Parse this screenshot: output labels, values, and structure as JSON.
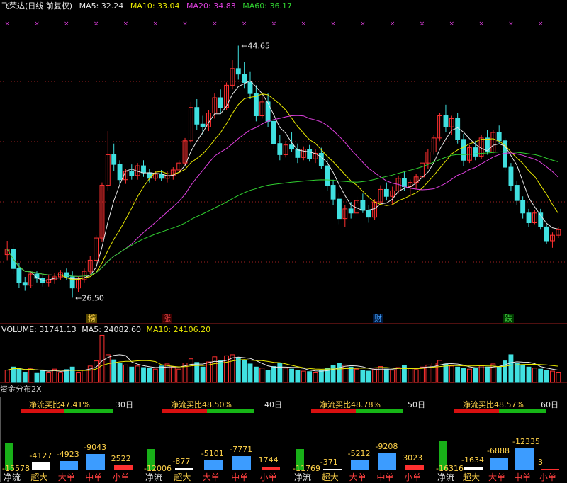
{
  "header": {
    "stock_name": "飞荣达(日线 前复权)",
    "ma_values": [
      {
        "label": "MA5: 32.24",
        "color": "#e8e8e8"
      },
      {
        "label": "MA10: 33.04",
        "color": "#e8e800"
      },
      {
        "label": "MA20: 34.83",
        "color": "#e040e0"
      },
      {
        "label": "MA60: 36.17",
        "color": "#30d030"
      }
    ]
  },
  "price_chart": {
    "high_label": "44.65",
    "low_label": "26.50",
    "markers": [
      {
        "text": "榜",
        "color": "#ffd24a"
      },
      {
        "text": "涨",
        "color": "#e04040"
      },
      {
        "text": "财",
        "color": "#40a0ff"
      },
      {
        "text": "跌",
        "color": "#40d040"
      }
    ],
    "colors": {
      "up": "#ff3030",
      "down": "#40e0e0",
      "ma5": "#e8e8e8",
      "ma10": "#e8e800",
      "ma20": "#e040e0",
      "ma60": "#30d030",
      "grid": "#a02020",
      "signal": "#e040e0"
    }
  },
  "volume_header": {
    "volume": "VOLUME: 31741.13",
    "ma5": "MA5: 24082.60",
    "ma10": "MA10: 24106.20"
  },
  "fund_flow": {
    "title": "资金分布2X",
    "categories": [
      "净流",
      "超大",
      "大单",
      "中单",
      "小单"
    ],
    "panels": [
      {
        "days": "30日",
        "ratio_label": "净流买比47.41%",
        "ratio": 47.41,
        "values": [
          -15578,
          -4127,
          -4923,
          -9043,
          2522
        ],
        "value_labels": [
          "-15578",
          "-4127",
          "-4923",
          "-9043",
          "2522"
        ]
      },
      {
        "days": "40日",
        "ratio_label": "净流买比48.50%",
        "ratio": 48.5,
        "values": [
          -12006,
          -877,
          -5101,
          -7771,
          1744
        ],
        "value_labels": [
          "-12006",
          "-877",
          "-5101",
          "-7771",
          "1744"
        ]
      },
      {
        "days": "50日",
        "ratio_label": "净流买比48.78%",
        "ratio": 48.78,
        "values": [
          -11769,
          -371,
          -5212,
          -9208,
          3023
        ],
        "value_labels": [
          "-11769",
          "-371",
          "-5212",
          "-9208",
          "3023"
        ]
      },
      {
        "days": "60日",
        "ratio_label": "净流买比48.57%",
        "ratio": 48.57,
        "values": [
          -16316,
          -1634,
          -6888,
          -12335,
          3
        ],
        "value_labels": [
          "-16316",
          "-1634",
          "-6888",
          "-12335",
          "3"
        ]
      }
    ]
  },
  "chart_data": {
    "type": "candlestick",
    "title": "飞荣达(日线 前复权)",
    "price_range": [
      25.5,
      46.0
    ],
    "ohlc": [
      [
        29.6,
        30.6,
        29.2,
        30.0
      ],
      [
        30.0,
        30.4,
        28.2,
        28.6
      ],
      [
        28.6,
        29.0,
        27.2,
        27.6
      ],
      [
        27.6,
        28.0,
        27.0,
        27.4
      ],
      [
        27.4,
        28.4,
        27.2,
        28.2
      ],
      [
        28.2,
        28.4,
        27.6,
        27.9
      ],
      [
        27.9,
        28.2,
        27.3,
        27.6
      ],
      [
        27.6,
        28.1,
        27.3,
        27.8
      ],
      [
        27.8,
        28.3,
        27.5,
        28.0
      ],
      [
        28.0,
        28.5,
        27.8,
        28.3
      ],
      [
        28.3,
        28.6,
        27.8,
        28.0
      ],
      [
        28.0,
        28.4,
        26.5,
        27.2
      ],
      [
        27.2,
        28.0,
        26.9,
        27.8
      ],
      [
        27.8,
        28.6,
        27.6,
        28.4
      ],
      [
        28.4,
        29.5,
        28.2,
        29.2
      ],
      [
        29.2,
        31.0,
        29.0,
        30.8
      ],
      [
        30.8,
        34.8,
        30.5,
        34.6
      ],
      [
        34.6,
        38.5,
        34.2,
        36.8
      ],
      [
        36.8,
        37.6,
        35.6,
        36.1
      ],
      [
        36.1,
        36.4,
        34.6,
        35.0
      ],
      [
        35.0,
        35.8,
        34.7,
        35.6
      ],
      [
        35.6,
        36.1,
        35.0,
        35.3
      ],
      [
        35.3,
        36.2,
        35.0,
        36.0
      ],
      [
        36.0,
        36.4,
        35.2,
        35.5
      ],
      [
        35.5,
        35.8,
        34.8,
        35.1
      ],
      [
        35.1,
        35.6,
        34.9,
        35.4
      ],
      [
        35.4,
        35.7,
        34.9,
        35.1
      ],
      [
        35.1,
        35.6,
        34.8,
        35.3
      ],
      [
        35.3,
        35.9,
        35.0,
        35.7
      ],
      [
        35.7,
        36.4,
        35.5,
        36.2
      ],
      [
        36.2,
        38.0,
        36.0,
        37.8
      ],
      [
        37.8,
        40.6,
        37.5,
        40.2
      ],
      [
        40.2,
        40.8,
        38.6,
        39.0
      ],
      [
        39.0,
        39.6,
        38.2,
        38.8
      ],
      [
        38.8,
        40.0,
        38.5,
        39.8
      ],
      [
        39.8,
        41.2,
        39.4,
        40.9
      ],
      [
        40.9,
        41.5,
        39.8,
        40.2
      ],
      [
        40.2,
        42.0,
        40.0,
        41.8
      ],
      [
        41.8,
        43.6,
        41.5,
        43.0
      ],
      [
        43.0,
        44.65,
        42.2,
        42.6
      ],
      [
        42.6,
        43.5,
        41.6,
        42.0
      ],
      [
        42.0,
        42.8,
        40.8,
        41.2
      ],
      [
        41.2,
        41.8,
        39.2,
        39.6
      ],
      [
        39.6,
        41.0,
        39.4,
        40.6
      ],
      [
        40.6,
        41.2,
        38.8,
        39.2
      ],
      [
        39.2,
        39.8,
        37.2,
        37.6
      ],
      [
        37.6,
        38.2,
        36.4,
        36.8
      ],
      [
        36.8,
        37.8,
        36.6,
        37.5
      ],
      [
        37.5,
        38.4,
        37.0,
        37.2
      ],
      [
        37.2,
        37.6,
        36.2,
        36.6
      ],
      [
        36.6,
        37.4,
        36.4,
        37.2
      ],
      [
        37.2,
        37.5,
        36.3,
        36.5
      ],
      [
        36.5,
        37.2,
        36.2,
        36.9
      ],
      [
        36.9,
        37.3,
        35.8,
        36.0
      ],
      [
        36.0,
        36.5,
        34.2,
        34.6
      ],
      [
        34.6,
        35.0,
        33.2,
        33.6
      ],
      [
        33.6,
        34.0,
        31.8,
        32.2
      ],
      [
        32.2,
        33.2,
        31.6,
        32.9
      ],
      [
        32.9,
        33.4,
        32.2,
        32.6
      ],
      [
        32.6,
        33.8,
        32.4,
        33.5
      ],
      [
        33.5,
        34.0,
        32.6,
        32.8
      ],
      [
        32.8,
        33.2,
        31.9,
        32.3
      ],
      [
        32.3,
        33.6,
        32.1,
        33.4
      ],
      [
        33.4,
        34.6,
        33.2,
        34.3
      ],
      [
        34.3,
        34.8,
        33.5,
        33.8
      ],
      [
        33.8,
        34.5,
        33.2,
        34.2
      ],
      [
        34.2,
        35.3,
        34.0,
        35.1
      ],
      [
        35.1,
        35.6,
        34.2,
        34.5
      ],
      [
        34.5,
        35.0,
        33.8,
        34.8
      ],
      [
        34.8,
        35.4,
        34.3,
        35.2
      ],
      [
        35.2,
        36.4,
        35.0,
        36.2
      ],
      [
        36.2,
        37.2,
        35.8,
        37.0
      ],
      [
        37.0,
        38.2,
        36.8,
        38.0
      ],
      [
        38.0,
        39.8,
        37.8,
        39.6
      ],
      [
        39.6,
        40.4,
        38.4,
        38.8
      ],
      [
        38.8,
        39.6,
        38.2,
        39.4
      ],
      [
        39.4,
        39.8,
        37.6,
        37.9
      ],
      [
        37.9,
        38.3,
        36.0,
        36.4
      ],
      [
        36.4,
        37.5,
        36.2,
        37.3
      ],
      [
        37.3,
        37.8,
        36.4,
        36.7
      ],
      [
        36.7,
        38.2,
        36.5,
        38.0
      ],
      [
        38.0,
        38.6,
        36.8,
        37.0
      ],
      [
        37.0,
        38.6,
        36.9,
        38.4
      ],
      [
        38.4,
        38.9,
        37.6,
        37.8
      ],
      [
        37.8,
        38.0,
        35.6,
        35.9
      ],
      [
        35.9,
        36.2,
        34.2,
        34.6
      ],
      [
        34.6,
        34.9,
        33.2,
        33.5
      ],
      [
        33.5,
        33.8,
        32.2,
        32.6
      ],
      [
        32.6,
        32.9,
        31.6,
        31.9
      ],
      [
        31.9,
        32.8,
        31.8,
        32.6
      ],
      [
        32.6,
        32.9,
        31.4,
        31.6
      ],
      [
        31.6,
        31.8,
        30.4,
        30.6
      ],
      [
        30.6,
        31.2,
        30.1,
        31.0
      ],
      [
        31.0,
        31.6,
        30.8,
        31.4
      ]
    ],
    "volume": [
      1200,
      1500,
      1350,
      1000,
      1380,
      950,
      1150,
      1000,
      1300,
      980,
      1250,
      1500,
      1000,
      1200,
      1600,
      2100,
      4600,
      2700,
      2200,
      1900,
      1700,
      1500,
      1600,
      1450,
      1400,
      1300,
      1600,
      1800,
      1500,
      1300,
      1900,
      2300,
      1950,
      1500,
      2000,
      2500,
      2150,
      2600,
      2700,
      2400,
      2200,
      1800,
      1500,
      1400,
      1200,
      1550,
      1900,
      1400,
      1300,
      1150,
      1100,
      1050,
      1000,
      1200,
      1400,
      1650,
      1900,
      1700,
      1500,
      1300,
      1200,
      1100,
      1300,
      1550,
      1300,
      1200,
      1450,
      1650,
      1400,
      1250,
      1500,
      1700,
      1900,
      2150,
      1800,
      1600,
      1500,
      1400,
      1300,
      1350,
      1600,
      1500,
      1800,
      1550,
      2100,
      2700,
      1900,
      1650,
      1500,
      1400,
      1300,
      1200,
      1100,
      1000
    ],
    "volume_range": [
      0,
      4700
    ]
  }
}
